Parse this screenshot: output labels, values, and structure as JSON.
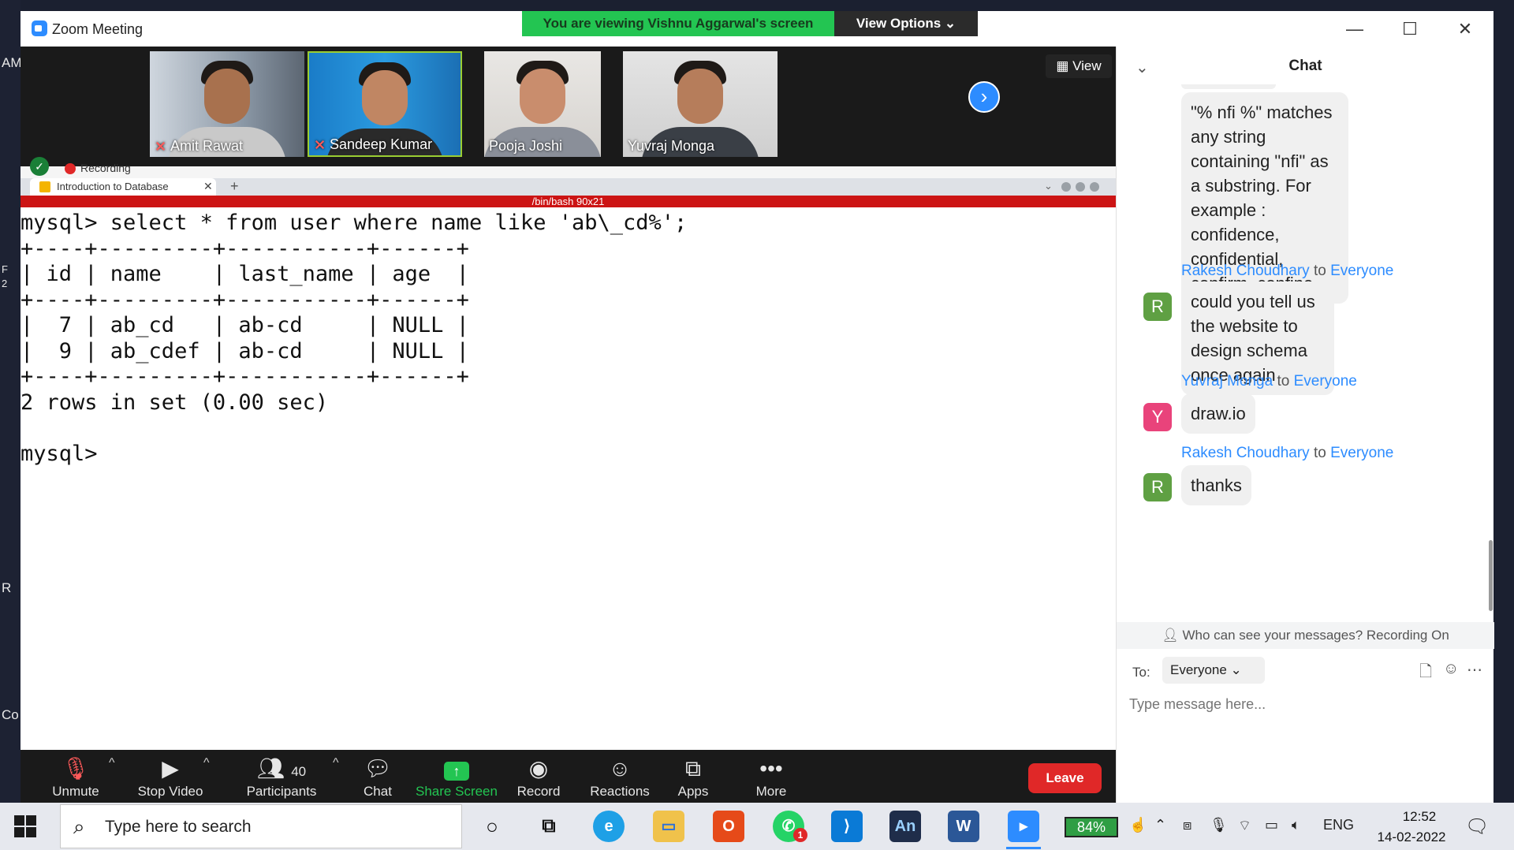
{
  "window": {
    "title": "Zoom Meeting"
  },
  "banner": {
    "viewing": "You are viewing Vishnu Aggarwal's screen",
    "view_options": "View Options ⌄"
  },
  "desktop_left": [
    "AM",
    "F",
    "2",
    "R",
    "Co"
  ],
  "participants": [
    {
      "name": "Amit Rawat",
      "muted": true
    },
    {
      "name": "Sandeep Kumar",
      "muted": true
    },
    {
      "name": "Pooja Joshi",
      "muted": false
    },
    {
      "name": "Yuvraj Monga",
      "muted": false
    }
  ],
  "video_strip": {
    "view_label": "View"
  },
  "recording": {
    "label": "Recording"
  },
  "browser": {
    "tab_title": "Introduction to Database"
  },
  "terminal": {
    "title": "/bin/bash 90x21",
    "lines": [
      "mysql> select * from user where name like 'ab\\_cd%';",
      "+----+---------+-----------+------+",
      "| id | name    | last_name | age  |",
      "+----+---------+-----------+------+",
      "|  7 | ab_cd   | ab-cd     | NULL |",
      "|  9 | ab_cdef | ab-cd     | NULL |",
      "+----+---------+-----------+------+",
      "2 rows in set (0.00 sec)",
      "",
      "mysql>"
    ]
  },
  "toolbar": {
    "unmute": "Unmute",
    "stop_video": "Stop Video",
    "participants": "Participants",
    "participants_count": "40",
    "chat": "Chat",
    "share_screen": "Share Screen",
    "record": "Record",
    "reactions": "Reactions",
    "apps": "Apps",
    "more": "More",
    "leave": "Leave"
  },
  "chat": {
    "title": "Chat",
    "first_bubble": "\"% nfi %\" matches any string containing \"nfi\" as a substring. For example : confidence, confidential, confirm, confine.",
    "messages": [
      {
        "sender": "Rakesh Choudhary",
        "to_word": "to",
        "recipient": "Everyone",
        "initial": "R",
        "avatar_color": "#5fa043",
        "text": "could you tell us the website to design schema once again"
      },
      {
        "sender": "Yuvraj Monga",
        "to_word": "to",
        "recipient": "Everyone",
        "initial": "Y",
        "avatar_color": "#e9437b",
        "text": "draw.io"
      },
      {
        "sender": "Rakesh Choudhary",
        "to_word": "to",
        "recipient": "Everyone",
        "initial": "R",
        "avatar_color": "#5fa043",
        "text": "thanks"
      }
    ],
    "privacy": "Who can see your messages? Recording On",
    "to_label": "To:",
    "to_value": "Everyone ⌄",
    "input_placeholder": "Type message here..."
  },
  "taskbar": {
    "search_placeholder": "Type here to search",
    "whatsapp_badge": "1",
    "battery": "84%",
    "language": "ENG",
    "time": "12:52",
    "date": "14-02-2022"
  }
}
